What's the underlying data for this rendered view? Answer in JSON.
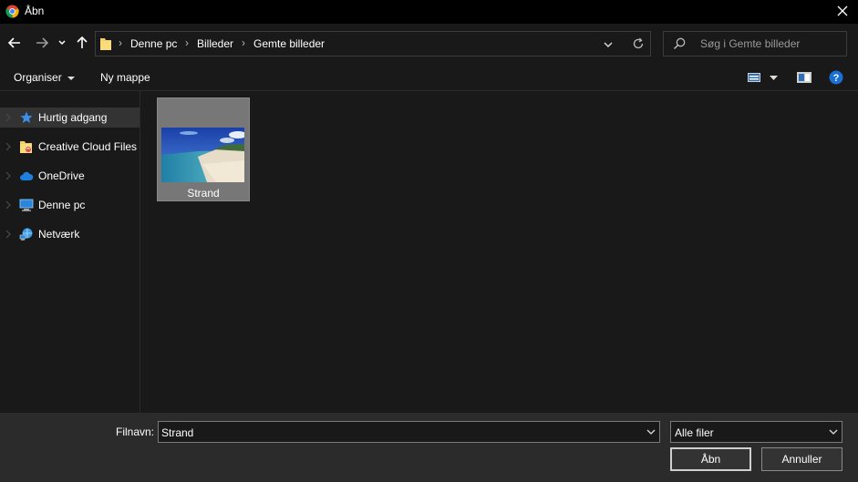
{
  "window": {
    "title": "Åbn"
  },
  "navigation": {
    "breadcrumb": [
      "Denne pc",
      "Billeder",
      "Gemte billeder"
    ]
  },
  "search": {
    "placeholder": "Søg i Gemte billeder"
  },
  "toolbar": {
    "organize_label": "Organiser",
    "new_folder_label": "Ny mappe"
  },
  "sidebar": {
    "items": [
      {
        "label": "Hurtig adgang",
        "icon": "star-icon",
        "selected": true
      },
      {
        "label": "Creative Cloud Files",
        "icon": "creative-cloud-folder-icon"
      },
      {
        "label": "OneDrive",
        "icon": "cloud-icon"
      },
      {
        "label": "Denne pc",
        "icon": "computer-icon"
      },
      {
        "label": "Netværk",
        "icon": "network-icon"
      }
    ]
  },
  "files": [
    {
      "name": "Strand",
      "type": "image",
      "selected": true
    }
  ],
  "footer": {
    "filename_label": "Filnavn:",
    "filename_value": "Strand",
    "filetype_value": "Alle filer",
    "open_label": "Åbn",
    "cancel_label": "Annuller"
  },
  "colors": {
    "background": "#191919",
    "titlebar": "#000000",
    "footer": "#2b2b2b",
    "selection": "#333333",
    "help_blue": "#1a6fd1"
  }
}
